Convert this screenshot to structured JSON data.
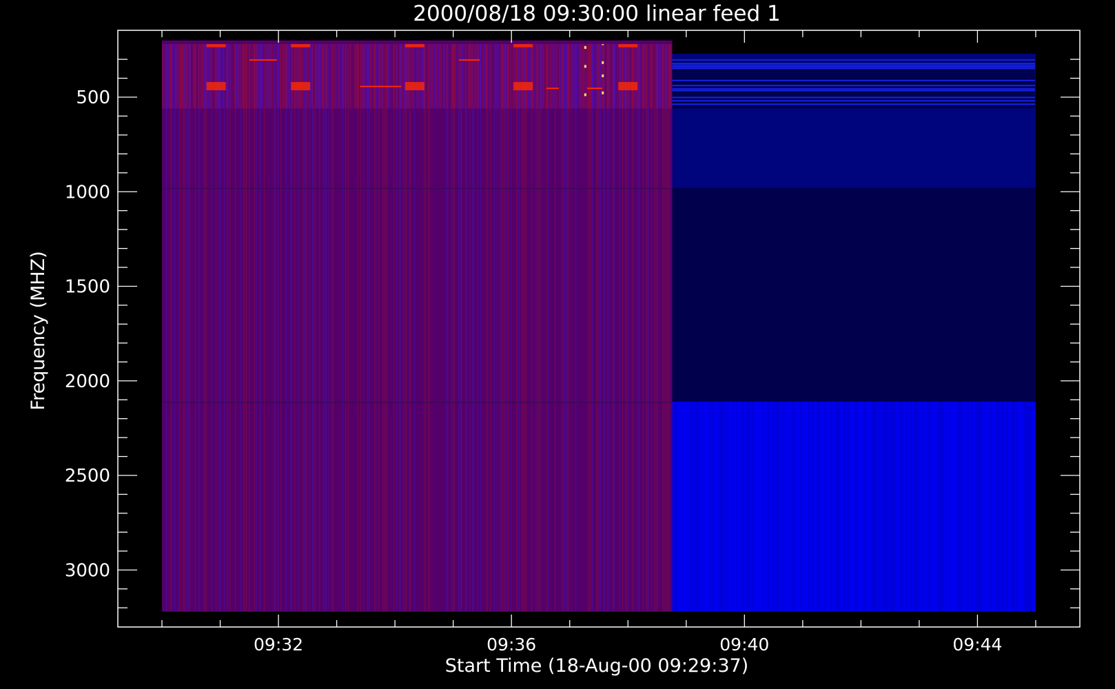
{
  "chart_data": {
    "type": "heatmap",
    "title": "2000/08/18 09:30:00 linear feed 1",
    "xlabel": "Start Time (18-Aug-00 09:29:37)",
    "ylabel": "Frequency (MHZ)",
    "x_ticks": [
      {
        "label": "09:32",
        "minutes": 2
      },
      {
        "label": "09:36",
        "minutes": 6
      },
      {
        "label": "09:40",
        "minutes": 10
      },
      {
        "label": "09:44",
        "minutes": 14
      }
    ],
    "x_minor_tick_step_minutes": 1,
    "y_ticks": [
      500,
      1000,
      1500,
      2000,
      2500,
      3000
    ],
    "y_minor_tick_step": 100,
    "y_inverted": true,
    "xlim_minutes_after_0930": [
      -0.77,
      15.77
    ],
    "ylim_mhz": [
      3000,
      300
    ],
    "blocks": [
      {
        "name": "",
        "t_start": 0.0,
        "t_end": 8.76,
        "f_low": 200,
        "f_high": 3220,
        "color": "#55006a"
      },
      {
        "name": "",
        "t_start": 8.76,
        "t_end": 15.0,
        "f_low": 270,
        "f_high": 980,
        "color": "#00057e"
      },
      {
        "name": "",
        "t_start": 8.76,
        "t_end": 15.0,
        "f_low": 980,
        "f_high": 2110,
        "color": "#00004c"
      },
      {
        "name": "",
        "t_start": 8.76,
        "t_end": 15.0,
        "f_low": 2110,
        "f_high": 3220,
        "color": "#0000ee"
      }
    ],
    "colors": {
      "background": "#000000",
      "axes": "#ffffff",
      "burst": "#ff2a00",
      "peak": "#ffe060"
    }
  }
}
